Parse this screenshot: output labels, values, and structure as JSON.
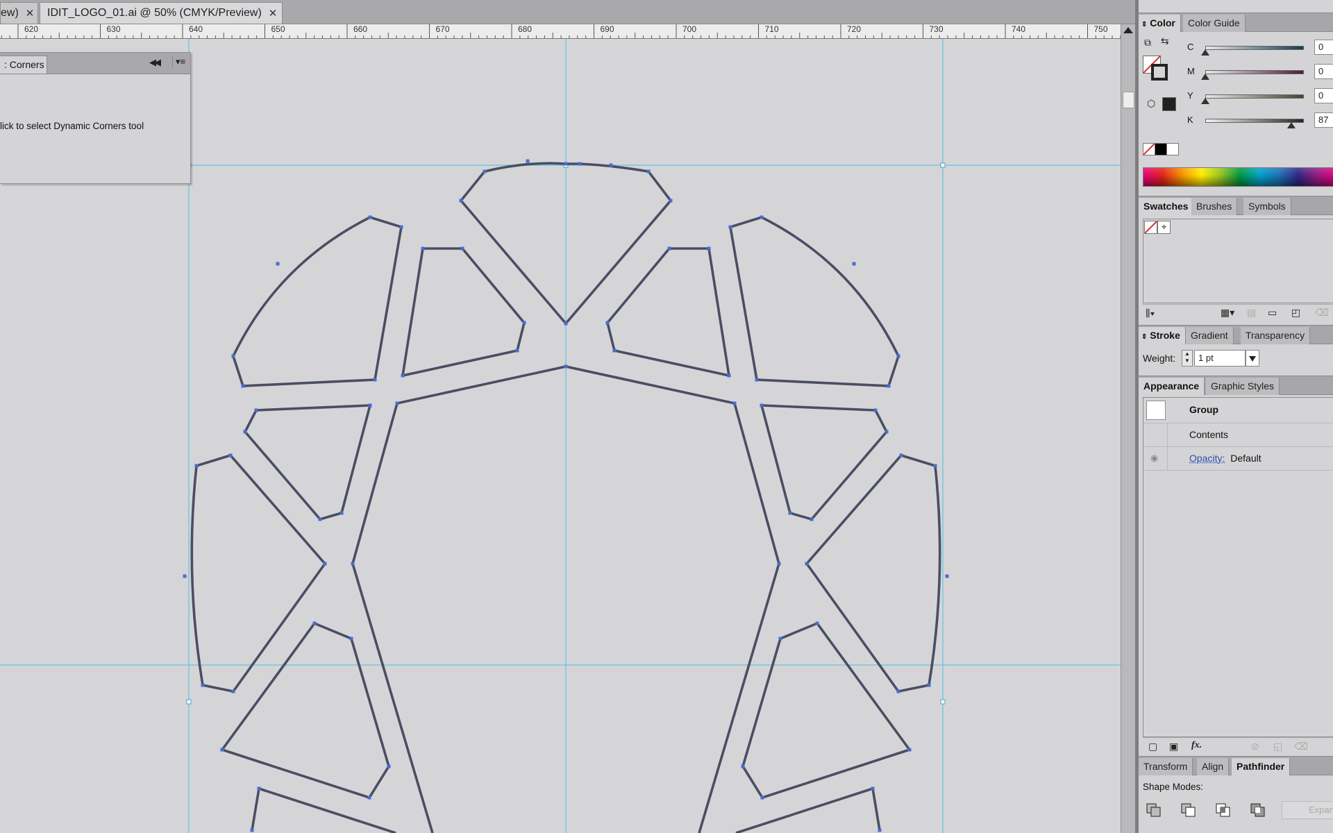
{
  "tabs": [
    {
      "label": "ew)",
      "close": "✕"
    },
    {
      "label": "IDIT_LOGO_01.ai @ 50% (CMYK/Preview)",
      "close": "✕"
    }
  ],
  "ruler": {
    "labels": [
      "620",
      "630",
      "640",
      "650",
      "660",
      "670",
      "680",
      "690",
      "700",
      "710",
      "720",
      "730",
      "740",
      "750"
    ]
  },
  "floating_panel": {
    "tab_label": ": Corners",
    "collapse_icon": "double-chevron-left-icon",
    "menu_icon": "panel-menu-icon",
    "message": "lick to select Dynamic Corners tool"
  },
  "color_panel": {
    "tabs": [
      "Color",
      "Color Guide"
    ],
    "active_tab": "Color",
    "cmyk": [
      {
        "label": "C",
        "value": "0",
        "level": 0
      },
      {
        "label": "M",
        "value": "0",
        "level": 0
      },
      {
        "label": "Y",
        "value": "0",
        "level": 0
      },
      {
        "label": "K",
        "value": "87",
        "level": 0.87
      }
    ],
    "fill_color": "#ffffff",
    "stroke_color": "#222222"
  },
  "swatches_panel": {
    "tabs": [
      "Swatches",
      "Brushes",
      "Symbols"
    ],
    "active_tab": "Swatches"
  },
  "stroke_panel": {
    "tabs": [
      "Stroke",
      "Gradient",
      "Transparency"
    ],
    "active_tab": "Stroke",
    "weight_label": "Weight:",
    "weight_value": "1 pt"
  },
  "appearance_panel": {
    "tabs": [
      "Appearance",
      "Graphic Styles"
    ],
    "active_tab": "Appearance",
    "object_type": "Group",
    "contents_label": "Contents",
    "opacity_label": "Opacity:",
    "opacity_value": "Default",
    "fx_label": "fx."
  },
  "pathfinder_panel": {
    "tabs": [
      "Transform",
      "Align",
      "Pathfinder"
    ],
    "active_tab": "Pathfinder",
    "shape_modes_label": "Shape Modes:",
    "expand_label": "Expan"
  },
  "colors": {
    "canvas_bg": "#d5d5d7",
    "guide": "#63c3de",
    "path_stroke": "#4a4e63",
    "anchor": "#4a6bd0"
  }
}
